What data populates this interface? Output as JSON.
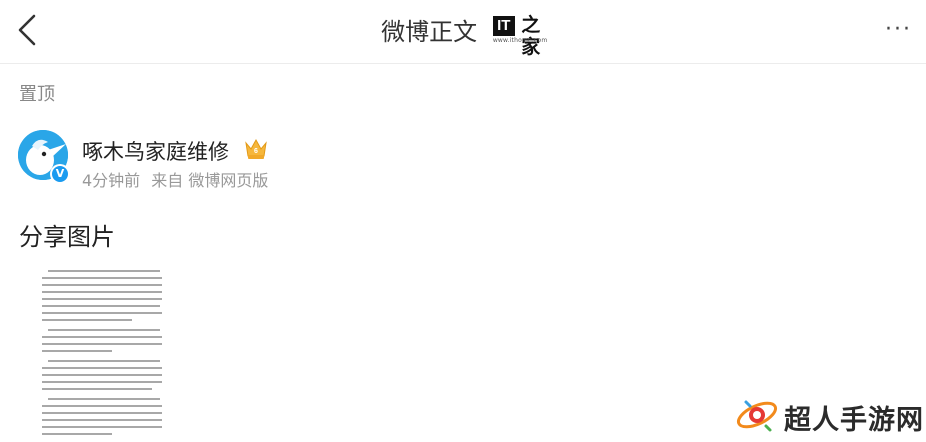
{
  "nav": {
    "title": "微博正文",
    "brand_mark": "IT之家",
    "brand_url": "www.ithome.com",
    "more_label": "···"
  },
  "section": {
    "pinned_label": "置顶"
  },
  "post": {
    "author": "啄木鸟家庭维修",
    "time": "4分钟前",
    "source": "来自 微博网页版",
    "text": "分享图片",
    "verified": true
  },
  "watermark": {
    "text": "超人手游网"
  },
  "colors": {
    "avatar_bg": "#2aa6e8",
    "verified_badge": "#1a9bf0",
    "crown": "#f6b73c",
    "muted_text": "#999999"
  },
  "icons": {
    "back": "chevron-left-icon",
    "more": "more-horizontal-icon",
    "crown": "crown-badge-icon",
    "verified": "verified-v-icon"
  }
}
